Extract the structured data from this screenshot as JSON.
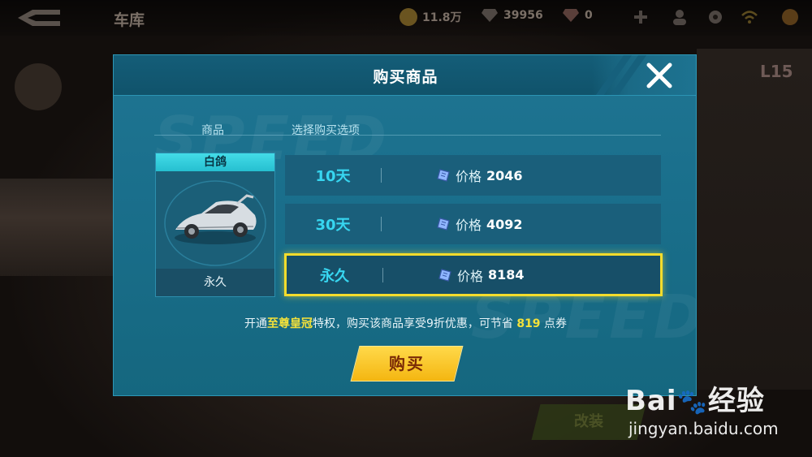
{
  "topbar": {
    "title": "车库",
    "coins": "11.8万",
    "diamonds": "39956",
    "gems": "0"
  },
  "side_panel": {
    "level": "L15"
  },
  "bottom": {
    "modify_label": "改装"
  },
  "dialog": {
    "title": "购买商品",
    "column_item": "商品",
    "column_options": "选择购买选项",
    "item": {
      "name": "白鸽",
      "duration": "永久"
    },
    "options": [
      {
        "days": "10天",
        "price_label": "价格",
        "price": "2046",
        "selected": false
      },
      {
        "days": "30天",
        "price_label": "价格",
        "price": "4092",
        "selected": false
      },
      {
        "days": "永久",
        "price_label": "价格",
        "price": "8184",
        "selected": true
      }
    ],
    "promo": {
      "prefix": "开通",
      "highlight": "至尊皇冠",
      "middle": "特权，购买该商品享受9折优惠，可节省",
      "amount": "819",
      "suffix": "点券"
    },
    "buy_label": "购买",
    "background_text": "SPEED"
  },
  "watermark": {
    "brand": "Bai",
    "brand_suffix": "百度",
    "product": "经验",
    "url": "jingyan.baidu.com"
  },
  "colors": {
    "accent_cyan": "#37d6f0",
    "selected_border": "#f4dc2c",
    "buy_button": "#f4b611"
  }
}
